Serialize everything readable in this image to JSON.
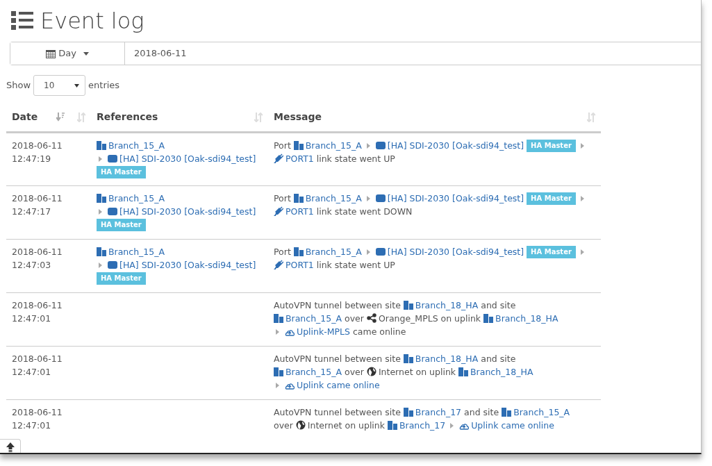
{
  "page": {
    "title": "Event log"
  },
  "date_filter": {
    "period": "Day",
    "value": "2018-06-11"
  },
  "page_length": {
    "before": "Show",
    "value": "10",
    "after": "entries"
  },
  "table": {
    "columns": [
      {
        "label": "Date",
        "sorted": true
      },
      {
        "sorted": false
      },
      {
        "label": "References",
        "sorted": false
      },
      {
        "label": "Message",
        "sorted": false
      }
    ],
    "rows": [
      {
        "date": "2018-06-11",
        "time": "12:47:19",
        "references": [
          {
            "kind": "site",
            "text": "Branch_15_A"
          },
          {
            "kind": "break"
          },
          {
            "kind": "caret"
          },
          {
            "kind": "device",
            "text": "[HA] SDI-2030 [Oak-sdi94_test]"
          },
          {
            "kind": "badge",
            "text": "HA Master"
          }
        ],
        "message": [
          {
            "kind": "text",
            "text": "Port"
          },
          {
            "kind": "site",
            "text": "Branch_15_A"
          },
          {
            "kind": "caret"
          },
          {
            "kind": "device",
            "text": "[HA] SDI-2030 [Oak-sdi94_test]"
          },
          {
            "kind": "badge",
            "text": "HA Master"
          },
          {
            "kind": "caret"
          },
          {
            "kind": "port",
            "text": "PORT1"
          },
          {
            "kind": "text",
            "text": "link state went UP"
          }
        ]
      },
      {
        "date": "2018-06-11",
        "time": "12:47:17",
        "references": [
          {
            "kind": "site",
            "text": "Branch_15_A"
          },
          {
            "kind": "break"
          },
          {
            "kind": "caret"
          },
          {
            "kind": "device",
            "text": "[HA] SDI-2030 [Oak-sdi94_test]"
          },
          {
            "kind": "badge",
            "text": "HA Master"
          }
        ],
        "message": [
          {
            "kind": "text",
            "text": "Port"
          },
          {
            "kind": "site",
            "text": "Branch_15_A"
          },
          {
            "kind": "caret"
          },
          {
            "kind": "device",
            "text": "[HA] SDI-2030 [Oak-sdi94_test]"
          },
          {
            "kind": "badge",
            "text": "HA Master"
          },
          {
            "kind": "caret"
          },
          {
            "kind": "port",
            "text": "PORT1"
          },
          {
            "kind": "text",
            "text": "link state went DOWN"
          }
        ]
      },
      {
        "date": "2018-06-11",
        "time": "12:47:03",
        "references": [
          {
            "kind": "site",
            "text": "Branch_15_A"
          },
          {
            "kind": "break"
          },
          {
            "kind": "caret"
          },
          {
            "kind": "device",
            "text": "[HA] SDI-2030 [Oak-sdi94_test]"
          },
          {
            "kind": "badge",
            "text": "HA Master"
          }
        ],
        "message": [
          {
            "kind": "text",
            "text": "Port"
          },
          {
            "kind": "site",
            "text": "Branch_15_A"
          },
          {
            "kind": "caret"
          },
          {
            "kind": "device",
            "text": "[HA] SDI-2030 [Oak-sdi94_test]"
          },
          {
            "kind": "badge",
            "text": "HA Master"
          },
          {
            "kind": "caret"
          },
          {
            "kind": "port",
            "text": "PORT1"
          },
          {
            "kind": "text",
            "text": "link state went UP"
          }
        ]
      },
      {
        "date": "2018-06-11",
        "time": "12:47:01",
        "message": [
          {
            "kind": "text",
            "text": "AutoVPN tunnel between site"
          },
          {
            "kind": "site",
            "text": "Branch_18_HA"
          },
          {
            "kind": "text",
            "text": "and site"
          },
          {
            "kind": "break"
          },
          {
            "kind": "site",
            "text": "Branch_15_A"
          },
          {
            "kind": "text",
            "text": "over"
          },
          {
            "kind": "network",
            "text": "Orange_MPLS"
          },
          {
            "kind": "text",
            "text": "on uplink"
          },
          {
            "kind": "site",
            "text": "Branch_18_HA"
          },
          {
            "kind": "break"
          },
          {
            "kind": "caret"
          },
          {
            "kind": "uplink",
            "text": "Uplink-MPLS"
          },
          {
            "kind": "text",
            "text": "came online"
          }
        ]
      },
      {
        "date": "2018-06-11",
        "time": "12:47:01",
        "message": [
          {
            "kind": "text",
            "text": "AutoVPN tunnel between site"
          },
          {
            "kind": "site",
            "text": "Branch_18_HA"
          },
          {
            "kind": "text",
            "text": "and site"
          },
          {
            "kind": "break"
          },
          {
            "kind": "site",
            "text": "Branch_15_A"
          },
          {
            "kind": "text",
            "text": "over"
          },
          {
            "kind": "internet",
            "text": "Internet"
          },
          {
            "kind": "text",
            "text": "on uplink"
          },
          {
            "kind": "site",
            "text": "Branch_18_HA"
          },
          {
            "kind": "break"
          },
          {
            "kind": "caret"
          },
          {
            "kind": "uplink",
            "text": "Uplink came online"
          }
        ]
      },
      {
        "date": "2018-06-11",
        "time": "12:47:01",
        "message": [
          {
            "kind": "text",
            "text": "AutoVPN tunnel between site"
          },
          {
            "kind": "site",
            "text": "Branch_17"
          },
          {
            "kind": "text",
            "text": "and site"
          },
          {
            "kind": "site",
            "text": "Branch_15_A"
          },
          {
            "kind": "break"
          },
          {
            "kind": "text",
            "text": "over"
          },
          {
            "kind": "internet",
            "text": "Internet"
          },
          {
            "kind": "text",
            "text": "on uplink"
          },
          {
            "kind": "site",
            "text": "Branch_17"
          },
          {
            "kind": "caret"
          },
          {
            "kind": "uplink",
            "text": "Uplink came online"
          }
        ]
      }
    ]
  }
}
